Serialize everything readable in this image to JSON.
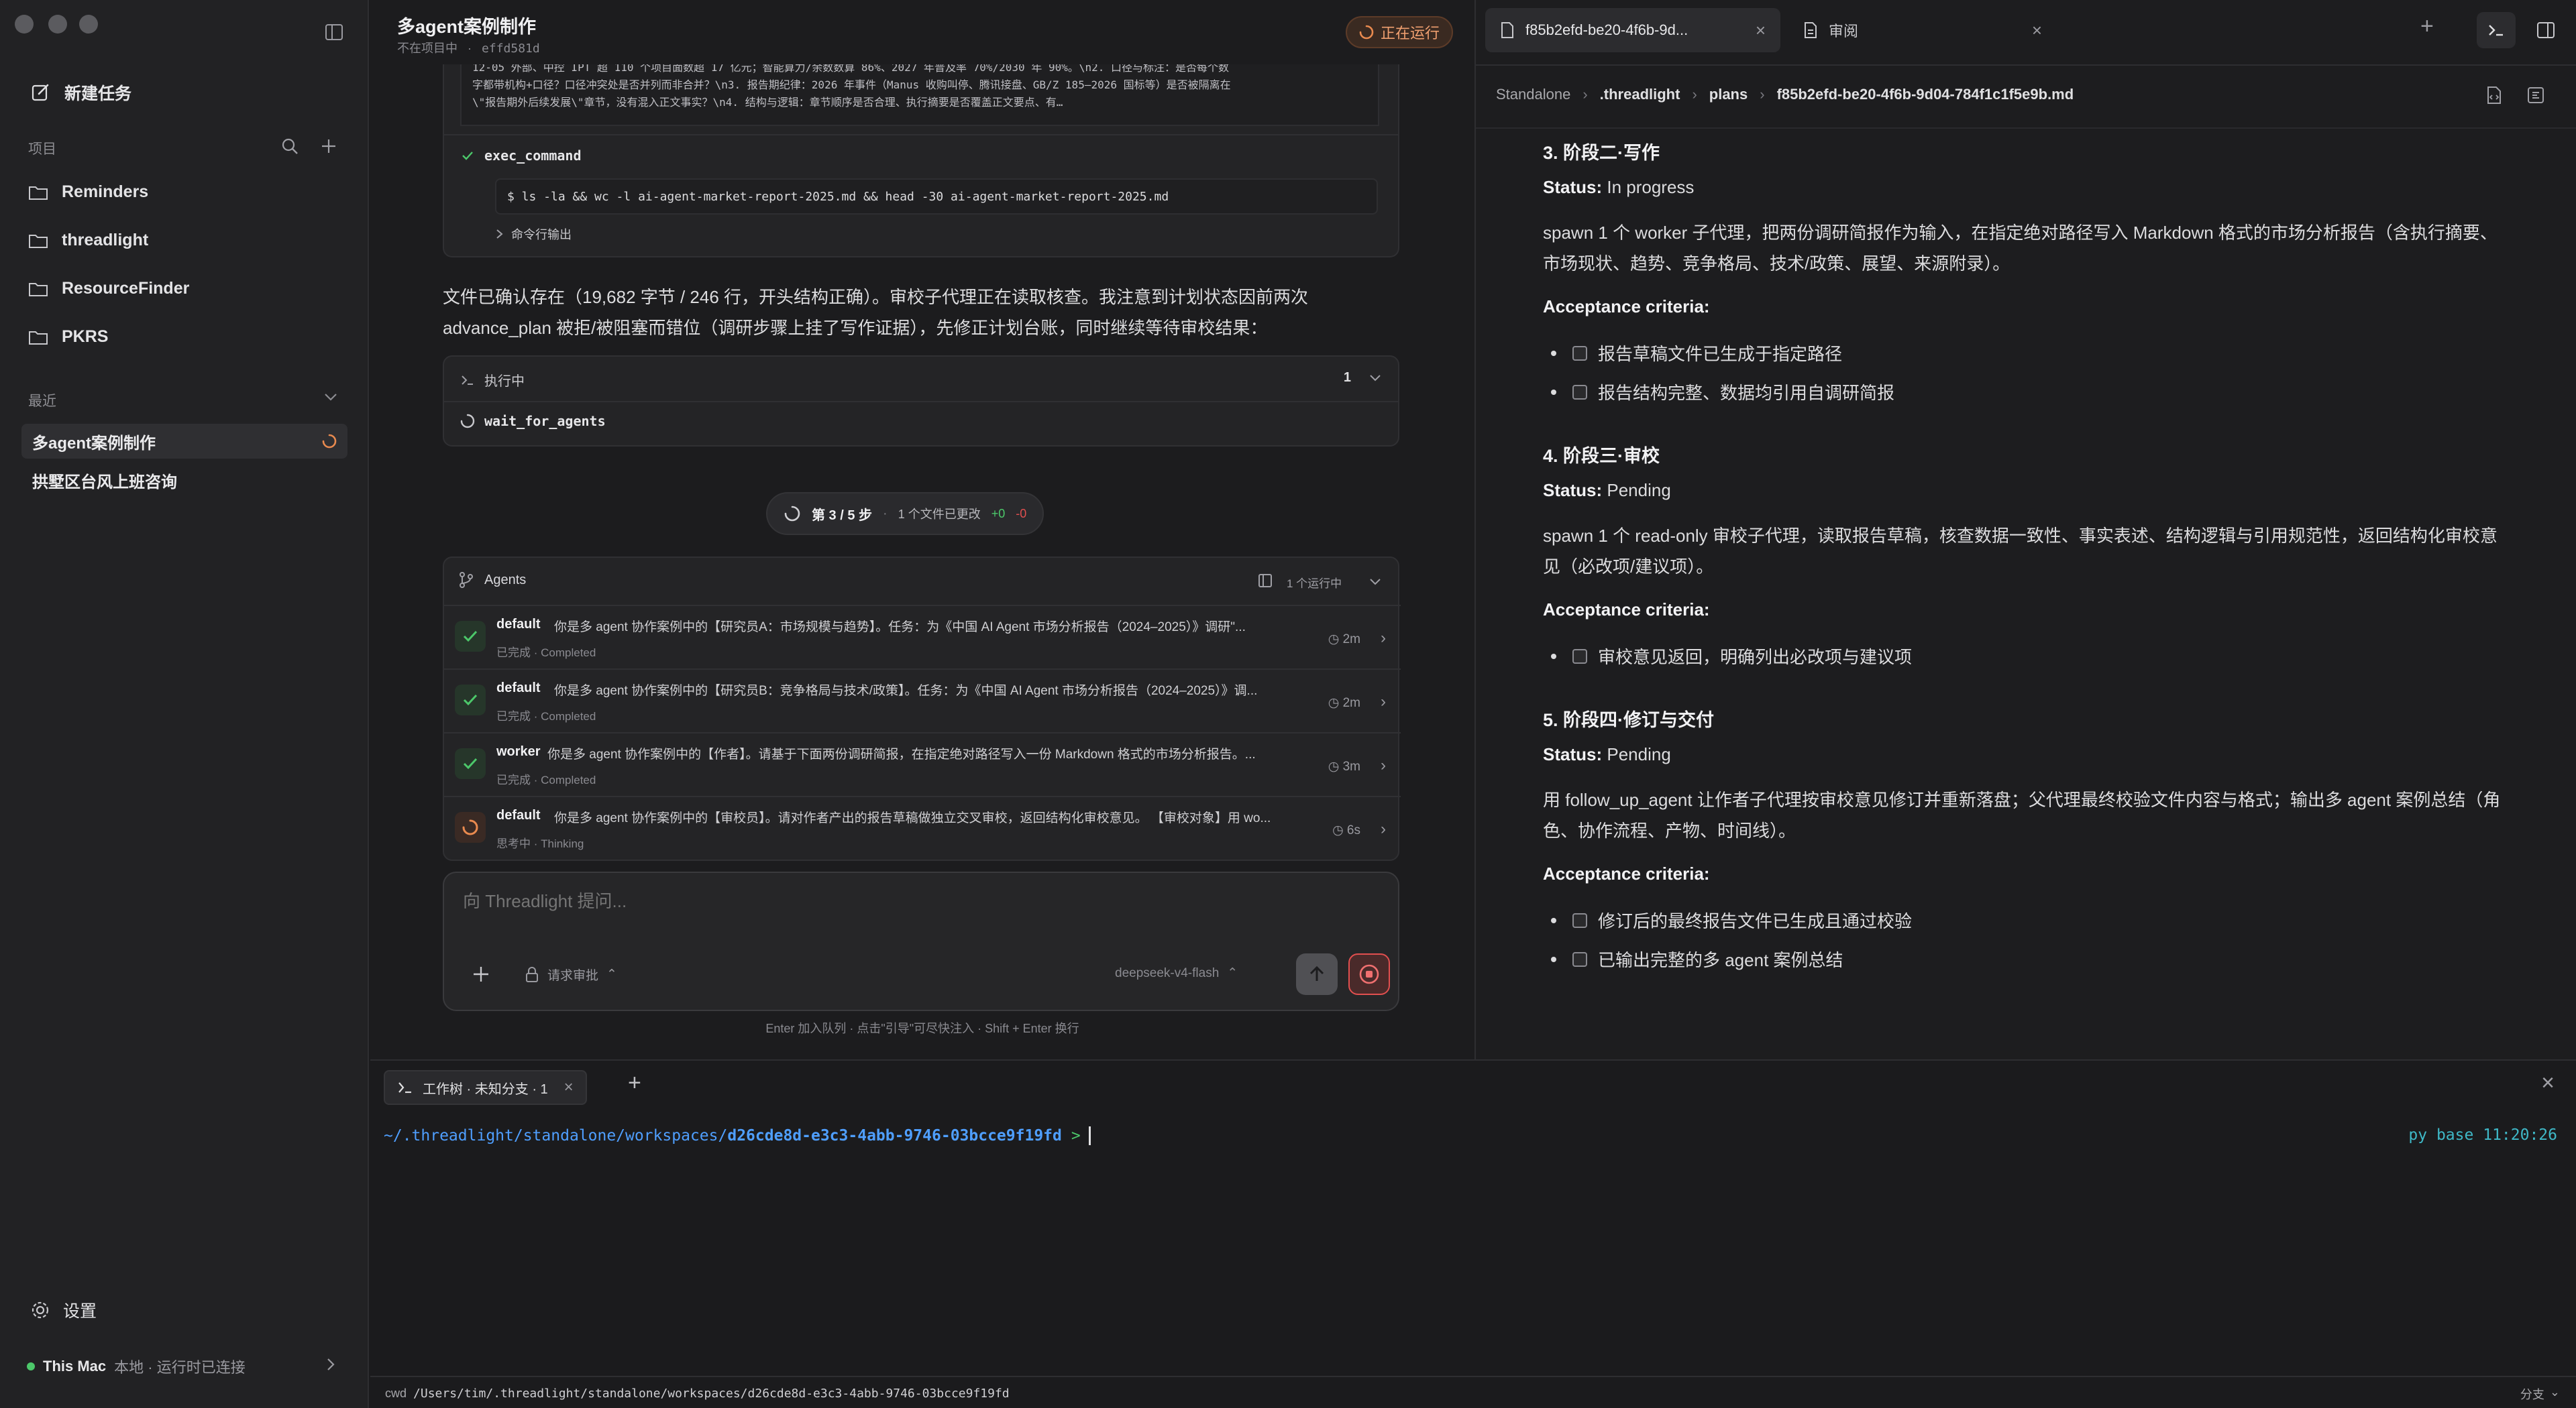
{
  "sidebar": {
    "new_task": "新建任务",
    "projects_label": "项目",
    "projects": [
      "Reminders",
      "threadlight",
      "ResourceFinder",
      "PKRS"
    ],
    "recent_label": "最近",
    "recent": [
      "多agent案例制作",
      "拱墅区台风上班咨询"
    ],
    "settings": "设置",
    "machine_name": "This Mac",
    "machine_status": "本地 · 运行时已连接"
  },
  "chat": {
    "title": "多agent案例制作",
    "subtitle_project": "不在项目中",
    "subtitle_hash": "effd581d",
    "running_badge": "正在运行",
    "snippet_line0": "12-05 外部、中控 IPT 超 110 个项目面数超 17 亿元；智能算力/余数数算 86%、2027 年普及率 70%/2030 年 90%。\\n2. 口径与标注：是否每个数",
    "snippet_line1": "字都带机构+口径？口径冲突处是否并列而非合并？\\n3. 报告期纪律：2026 年事件（Manus 收购叫停、腾讯接盘、GB/Z 185—2026 国标等）是否被隔离在",
    "snippet_line2": "\\\"报告期外后续发展\\\"章节，没有混入正文事实？\\n4. 结构与逻辑：章节顺序是否合理、执行摘要是否覆盖正文要点、有…",
    "exec_label": "exec_command",
    "exec_cmd": "$ ls -la && wc -l ai-agent-market-report-2025.md && head -30 ai-agent-market-report-2025.md",
    "exec_output_toggle": "命令行输出",
    "message_line1": "文件已确认存在（19,682 字节 / 246 行，开头结构正确）。审校子代理正在读取核查。我注意到计划状态因前两次",
    "message_line2": "advance_plan 被拒/被阻塞而错位（调研步骤上挂了写作证据），先修正计划台账，同时继续等待审校结果：",
    "executing_label": "执行中",
    "executing_count": "1",
    "wait_label": "wait_for_agents",
    "step_label": "第 3 / 5 步",
    "files_changed": "1 个文件已更改",
    "diff_add": "+0",
    "diff_del": "-0",
    "agents_label": "Agents",
    "agents_running": "1 个运行中",
    "agents": [
      {
        "name": "default",
        "desc": "你是多 agent 协作案例中的【研究员A：市场规模与趋势】。任务：为《中国 AI Agent 市场分析报告（2024–2025）》调研\"...",
        "status_cn": "已完成",
        "status_en": "Completed",
        "time": "2m",
        "state": "done"
      },
      {
        "name": "default",
        "desc": "你是多 agent 协作案例中的【研究员B：竞争格局与技术/政策】。任务：为《中国 AI Agent 市场分析报告（2024–2025）》调...",
        "status_cn": "已完成",
        "status_en": "Completed",
        "time": "2m",
        "state": "done"
      },
      {
        "name": "worker",
        "desc": "你是多 agent 协作案例中的【作者】。请基于下面两份调研简报，在指定绝对路径写入一份 Markdown 格式的市场分析报告。...",
        "status_cn": "已完成",
        "status_en": "Completed",
        "time": "3m",
        "state": "done"
      },
      {
        "name": "default",
        "desc": "你是多 agent 协作案例中的【审校员】。请对作者产出的报告草稿做独立交叉审校，返回结构化审校意见。 【审校对象】用 wo...",
        "status_cn": "思考中",
        "status_en": "Thinking",
        "time": "6s",
        "state": "thinking"
      }
    ],
    "input_placeholder": "向 Threadlight 提问...",
    "approval_label": "请求审批",
    "model_label": "deepseek-v4-flash",
    "hint": "Enter 加入队列 · 点击\"引导\"可尽快注入 · Shift + Enter 换行"
  },
  "right": {
    "tab1": "f85b2efd-be20-4f6b-9d...",
    "tab2": "审阅",
    "breadcrumb": [
      "Standalone",
      ".threadlight",
      "plans",
      "f85b2efd-be20-4f6b-9d04-784f1c1f5e9b.md"
    ],
    "sec3_title": "3. 阶段二·写作",
    "status_label": "Status:",
    "sec3_status": "In progress",
    "sec3_line1": "spawn 1 个 worker 子代理，把两份调研简报作为输入，在指定绝对路径写入 Markdown 格式的市场分析报告（含执行摘要、",
    "sec3_line2": "市场现状、趋势、竞争格局、技术/政策、展望、来源附录）。",
    "acc_label": "Acceptance criteria:",
    "sec3_items": [
      "报告草稿文件已生成于指定路径",
      "报告结构完整、数据均引用自调研简报"
    ],
    "sec4_title": "4. 阶段三·审校",
    "sec4_status": "Pending",
    "sec4_line1": "spawn 1 个 read-only 审校子代理，读取报告草稿，核查数据一致性、事实表述、结构逻辑与引用规范性，返回结构化审校意",
    "sec4_line2": "见（必改项/建议项）。",
    "sec4_items": [
      "审校意见返回，明确列出必改项与建议项"
    ],
    "sec5_title": "5. 阶段四·修订与交付",
    "sec5_status": "Pending",
    "sec5_line1": "用 follow_up_agent 让作者子代理按审校意见修订并重新落盘；父代理最终校验文件内容与格式；输出多 agent 案例总结（角",
    "sec5_line2": "色、协作流程、产物、时间线）。",
    "sec5_items": [
      "修订后的最终报告文件已生成且通过校验",
      "已输出完整的多 agent 案例总结"
    ]
  },
  "terminal": {
    "tab_label": "工作树 · 未知分支 · 1",
    "path_prefix": "~/.threadlight/standalone/workspaces/",
    "path_id": "d26cde8d-e3c3-4abb-9746-03bcce9f19fd",
    "prompt": ">",
    "env": "py base",
    "time": "11:20:26",
    "cwd_label": "cwd",
    "cwd": "/Users/tim/.threadlight/standalone/workspaces/d26cde8d-e3c3-4abb-9746-03bcce9f19fd",
    "branch_label": "分支"
  },
  "colors": {
    "accent": "#4f9fff",
    "running": "#e98a4f",
    "success": "#4cc86a",
    "danger": "#e14f4f"
  }
}
